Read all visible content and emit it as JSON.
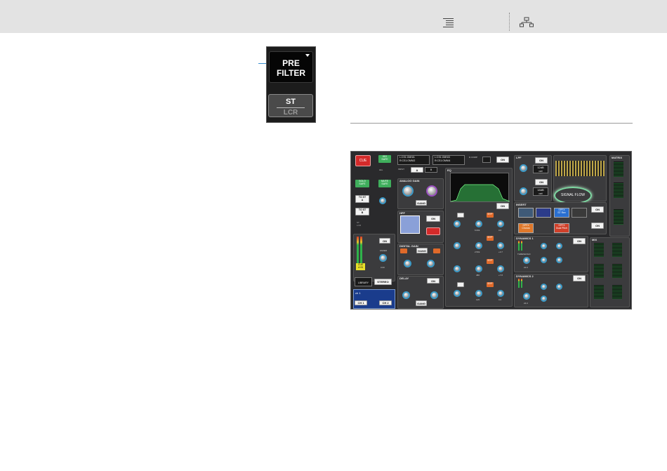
{
  "header": {
    "toc_icon": "toc-list-icon",
    "sitemap_icon": "sitemap-icon"
  },
  "panel_crop": {
    "prefilter_label_1": "PRE",
    "prefilter_label_2": "FILTER",
    "st_label": "ST",
    "lcr_label": "LCR"
  },
  "screen": {
    "cue_label": "CUE",
    "iso_safe": "ISO\nSAFE",
    "all_label": "ALL",
    "solo_safe": "SOLO\nSAFE",
    "mute_safe": "MUTE\nSAFE",
    "to_st_a": "TO ST\nA",
    "to_st_b": "TO ST\nB",
    "st_lcr": "ST\nLCR",
    "port_1": "L:CS1:OMNI1",
    "port_2": "R:CS1:OMNI2",
    "port_3": "L:CS1:OMNI3",
    "port_4": "R:CS1:OMNI4",
    "input_label": "INPUT",
    "a_label": "A",
    "b_label": "B",
    "delay_top_label": "D.COMP",
    "on": "ON",
    "analog_gain": "ANALOG GAIN",
    "gang": "GANG",
    "hpf": "HPF",
    "digital_gain": "DIGITAL GAIN",
    "delay": "DELAY",
    "eq": "EQ",
    "lpf": "LPF",
    "hpf_slope": "12dB\noct",
    "hpf2_slope": "18dB\noct",
    "freq": "FREQ",
    "q": "Q",
    "gain": "GAIN",
    "byp": "BYP",
    "insert": "INSERT",
    "dynamics_1": "DYNAMICS 1",
    "dynamics_2": "DYNAMICS 2",
    "threshold": "THRESHOLD",
    "ratio": "RATIO",
    "attack": "ATTACK",
    "hold": "HOLD",
    "decay": "DECAY",
    "range": "RANGE",
    "type": "TYPE",
    "matrix": "MATRIX",
    "mix": "MIX",
    "fader": "FADER",
    "library": "LIBRARY",
    "stereo": "STEREO",
    "ch_name": "ch 1",
    "ch_a": "CH 1",
    "ch_b": "CH 2",
    "signal_flow": "SIGNAL FLOW",
    "fader_value": "0.00",
    "a_plus_b": "A+B",
    "eq_band_vals": [
      "6.00k",
      "2.50k",
      "480",
      "125"
    ],
    "gain_vals": [
      "0.0",
      "+0.7",
      "+7.8",
      "0.0"
    ],
    "spfx_1": "SPFX\nChorus",
    "spfx_2": "SPFX\nDual Pitch",
    "spfx_3": "SPFX\nST Rev",
    "dyn_vals": [
      "22.0",
      "2.0",
      "60.0",
      "24.0"
    ],
    "dsp_label": "DSP SET 1"
  }
}
